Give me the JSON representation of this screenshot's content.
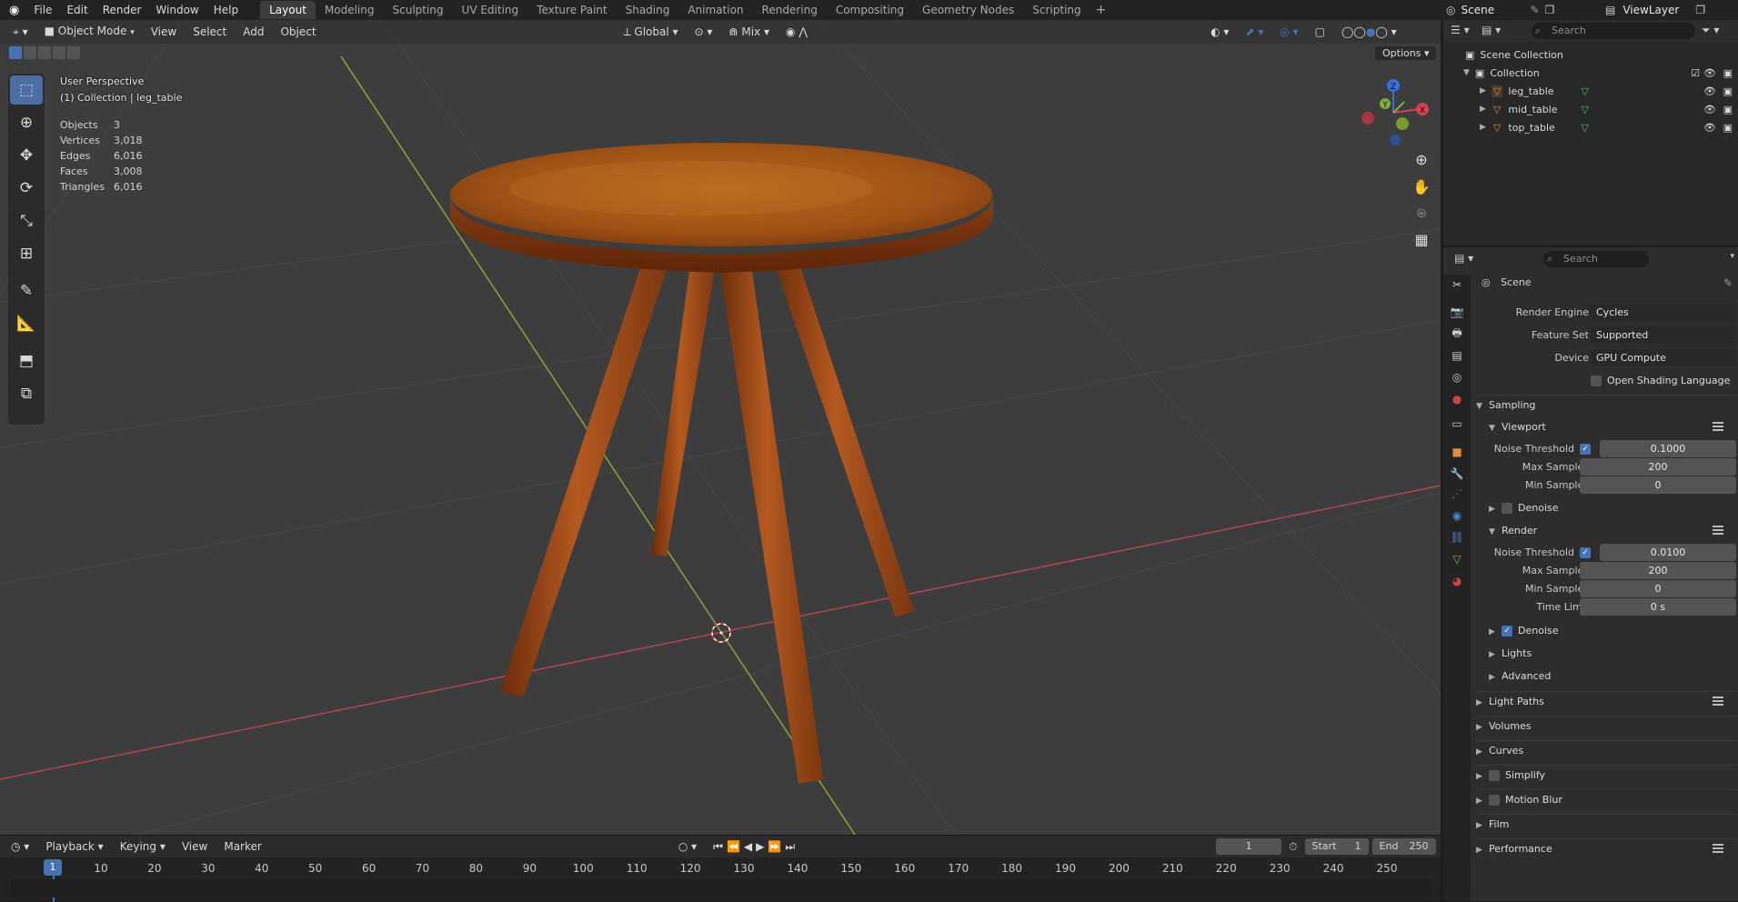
{
  "topbar": {
    "menus": [
      "File",
      "Edit",
      "Render",
      "Window",
      "Help"
    ],
    "workspaces": [
      "Layout",
      "Modeling",
      "Sculpting",
      "UV Editing",
      "Texture Paint",
      "Shading",
      "Animation",
      "Rendering",
      "Compositing",
      "Geometry Nodes",
      "Scripting"
    ],
    "active_workspace": "Layout",
    "scene_name": "Scene",
    "view_layer": "ViewLayer"
  },
  "viewport_header": {
    "mode": "Object Mode",
    "menus": [
      "View",
      "Select",
      "Add",
      "Object"
    ],
    "orientation": "Global",
    "snap": "Mix",
    "options_label": "Options"
  },
  "overlay": {
    "perspective": "User Perspective",
    "collection_info": "(1) Collection | leg_table",
    "stats": [
      {
        "label": "Objects",
        "value": "3"
      },
      {
        "label": "Vertices",
        "value": "3,018"
      },
      {
        "label": "Edges",
        "value": "6,016"
      },
      {
        "label": "Faces",
        "value": "3,008"
      },
      {
        "label": "Triangles",
        "value": "6,016"
      }
    ]
  },
  "gizmo": {
    "x": "X",
    "y": "Y",
    "z": "Z"
  },
  "outliner": {
    "search_placeholder": "Search",
    "scene_collection": "Scene Collection",
    "collection": "Collection",
    "objects": [
      "leg_table",
      "mid_table",
      "top_table"
    ]
  },
  "properties": {
    "search_placeholder": "Search",
    "context": "Scene",
    "render_engine_label": "Render Engine",
    "render_engine": "Cycles",
    "feature_set_label": "Feature Set",
    "feature_set": "Supported",
    "device_label": "Device",
    "device": "GPU Compute",
    "osl_label": "Open Shading Language",
    "sampling": "Sampling",
    "viewport": "Viewport",
    "noise_threshold_label": "Noise Threshold",
    "viewport_noise_threshold": "0.1000",
    "max_samples_label": "Max Samples",
    "viewport_max_samples": "200",
    "min_samples_label": "Min Samples",
    "viewport_min_samples": "0",
    "denoise_label": "Denoise",
    "render": "Render",
    "render_noise_threshold": "0.0100",
    "render_max_samples": "200",
    "render_min_samples": "0",
    "time_limit_label": "Time Limit",
    "time_limit": "0 s",
    "lights": "Lights",
    "advanced": "Advanced",
    "light_paths": "Light Paths",
    "volumes": "Volumes",
    "curves": "Curves",
    "simplify": "Simplify",
    "motion_blur": "Motion Blur",
    "film": "Film",
    "performance": "Performance"
  },
  "timeline": {
    "menus": [
      "Playback",
      "Keying",
      "View",
      "Marker"
    ],
    "current_frame": "1",
    "start_label": "Start",
    "start": "1",
    "end_label": "End",
    "end": "250",
    "ticks": [
      "1",
      "10",
      "20",
      "30",
      "40",
      "50",
      "60",
      "70",
      "80",
      "90",
      "100",
      "110",
      "120",
      "130",
      "140",
      "150",
      "160",
      "170",
      "180",
      "190",
      "200",
      "210",
      "220",
      "230",
      "240",
      "250"
    ]
  },
  "colors": {
    "accent": "#4772b3",
    "wood": "#9a4a1a",
    "x_axis": "#b0464f",
    "y_axis": "#8aa53a"
  }
}
